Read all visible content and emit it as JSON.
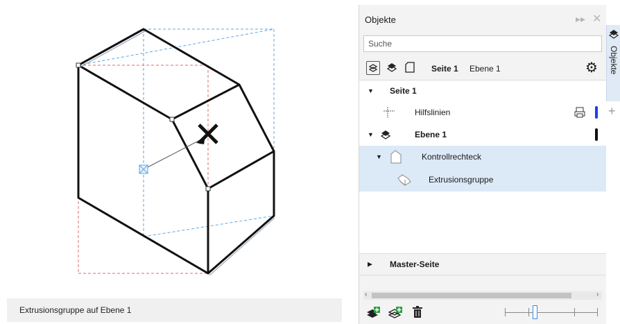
{
  "status_bar": {
    "text": "Extrusionsgruppe auf Ebene 1"
  },
  "panel": {
    "title": "Objekte",
    "search_placeholder": "Suche",
    "toolbar": {
      "page_label": "Seite 1",
      "layer_label": "Ebene 1"
    },
    "tree": [
      {
        "label": "Seite 1",
        "level": 0,
        "expanded": true,
        "bold": true
      },
      {
        "label": "Hilfslinien",
        "level": 1,
        "color": "#1f3de8"
      },
      {
        "label": "Ebene 1",
        "level": 1,
        "expanded": true,
        "bold": true,
        "color": "#111111"
      },
      {
        "label": "Kontrollrechteck",
        "level": 2,
        "expanded": true,
        "selected": true
      },
      {
        "label": "Extrusionsgruppe",
        "level": 3,
        "selected": true
      }
    ],
    "master_page": {
      "label": "Master-Seite",
      "expanded": false
    },
    "side_tab_label": "Objekte"
  },
  "colors": {
    "selection": "#dce9f7",
    "guides_color": "#1f3de8",
    "accent": "#3a8be0"
  }
}
